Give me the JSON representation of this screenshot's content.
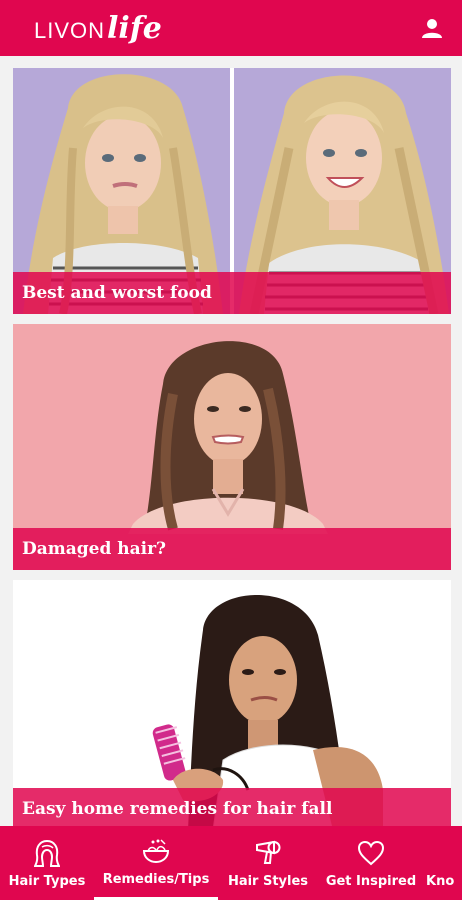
{
  "header": {
    "logo_part1": "LIVON",
    "logo_part2": "life",
    "profile_icon": "user-icon"
  },
  "cards": [
    {
      "caption": "Best and worst food"
    },
    {
      "caption": "Damaged hair?"
    },
    {
      "caption": "Easy home remedies for hair fall"
    }
  ],
  "bottom_nav": {
    "items": [
      {
        "label": "Hair Types",
        "icon": "hair-head-icon"
      },
      {
        "label": "Remedies/Tips",
        "icon": "bowl-icon",
        "active": true
      },
      {
        "label": "Hair Styles",
        "icon": "hair-dryer-icon"
      },
      {
        "label": "Get Inspired",
        "icon": "heart-icon"
      },
      {
        "label": "Kno",
        "icon": ""
      }
    ]
  },
  "colors": {
    "brand": "#e0064f",
    "background": "#f2f2f2"
  }
}
